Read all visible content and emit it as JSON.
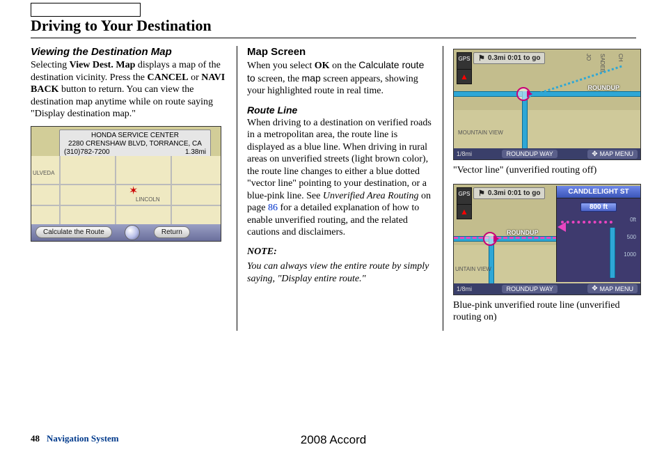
{
  "header": {
    "title": "Driving to Your Destination"
  },
  "col1": {
    "heading": "Viewing the Destination Map",
    "para1_pre": " Selecting ",
    "para1_b1": "View Dest. Map",
    "para1_mid1": " displays a map of the destination vicinity. Press the ",
    "para1_b2": "CANCEL",
    "para1_mid2": " or ",
    "para1_b3": "NAVI BACK",
    "para1_post": " button to return. You can view the destination map anytime while on route saying \"Display destination map.\"",
    "screenshot": {
      "banner_line1": "HONDA SERVICE CENTER",
      "banner_line2": "2280 CRENSHAW BLVD, TORRANCE, CA",
      "banner_phone": "(310)782-7200",
      "banner_dist": "1.38mi",
      "streets": {
        "s1": "ULVEDA",
        "s2": "LINCOLN"
      },
      "btn_calc": "Calculate the Route",
      "btn_return": "Return"
    }
  },
  "col2": {
    "heading": "Map Screen",
    "para1_pre": "When you select ",
    "para1_b1": "OK",
    "para1_mid1": " on the ",
    "para1_s1": "Calculate route to",
    "para1_mid2": " screen, the ",
    "para1_s2": "map",
    "para1_post": " screen appears, showing your highlighted route in real time.",
    "sub1": "Route Line",
    "para2_a": "When driving to a destination on verified roads in a metropolitan area, the route line is displayed as a blue line. When driving in rural areas on unverified streets (light brown color), the route line changes to either a blue dotted \"vector line\" pointing to your destination, or a blue-pink line. See ",
    "para2_link_ital": "Unverified Area Routing",
    "para2_mid": " on page ",
    "para2_pg": "86",
    "para2_b": " for a detailed explanation of how to enable unverified routing, and the related cautions and disclaimers.",
    "note_label": "NOTE:",
    "note_text": "You can always view the entire route by simply saying, \"Display entire route.\""
  },
  "col3": {
    "shot_a": {
      "dist": "0.3mi 0:01 to go",
      "gps": "GPS",
      "roundup": "ROUNDUP",
      "mountain": "MOUNTAIN  VIEW",
      "scale": "1/8mi",
      "road_name": "ROUNDUP WAY",
      "menu": "MAP MENU",
      "v1": "JO",
      "v2": "SADEB",
      "v3": "CH"
    },
    "caption1": "\"Vector line\" (unverified routing off)",
    "shot_b": {
      "dist": "0.3mi 0:01 to go",
      "gps": "GPS",
      "roundup": "ROUNDUP",
      "mountain": "UNTAIN  VIEW",
      "scale": "1/8mi",
      "road_name": "ROUNDUP WAY",
      "menu": "MAP MENU",
      "street_banner": "CANDLELIGHT ST",
      "badge": "800 ft",
      "t0": "0ft",
      "t500": "500",
      "t1000": "1000"
    },
    "caption2": " Blue-pink unverified route line (unverified routing on)"
  },
  "footer": {
    "page": "48",
    "section": "Navigation System",
    "model": "2008  Accord"
  }
}
